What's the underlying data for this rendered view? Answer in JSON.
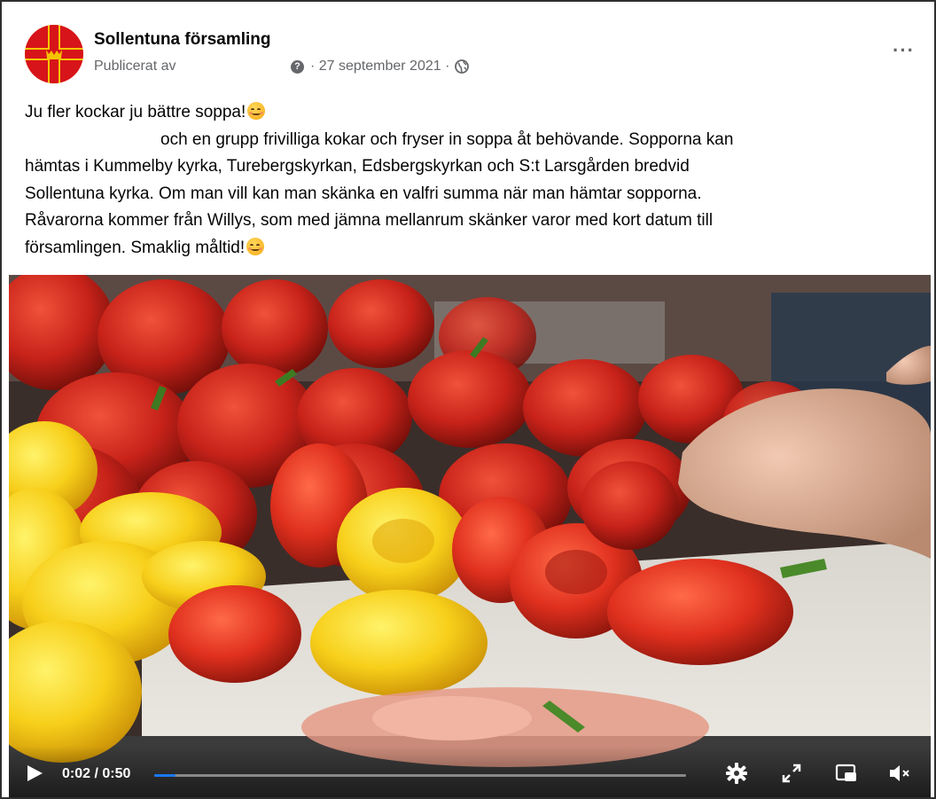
{
  "post": {
    "page_name": "Sollentuna församling",
    "published_by": "Publicerat av",
    "date_text": "· 27 september 2021 ·",
    "more_label": "···",
    "text_lines": [
      "Ju fler kockar ju bättre soppa!",
      "och en grupp frivilliga kokar och fryser in soppa åt behövande. Sopporna kan",
      "hämtas i Kummelby kyrka, Turebergskyrkan, Edsbergskyrkan och S:t Larsgården bredvid",
      "Sollentuna kyrka. Om man vill kan man skänka en valfri summa när man hämtar sopporna.",
      "Råvarorna kommer från Willys, som med jämna mellanrum skänker varor med kort datum till",
      "församlingen. Smaklig måltid!"
    ],
    "emoji": "smiling-face-emoji",
    "help_icon_glyph": "?"
  },
  "video": {
    "time": "0:02 / 0:50",
    "progress": 0.04,
    "accent": "#1877f2",
    "icons": [
      "play-icon",
      "settings-gear-icon",
      "fullscreen-expand-icon",
      "picture-in-picture-icon",
      "volume-muted-icon"
    ]
  },
  "colors": {
    "brand_red": "#d7141a",
    "brand_yellow": "#f5c400",
    "secondary_text": "#65676b"
  }
}
